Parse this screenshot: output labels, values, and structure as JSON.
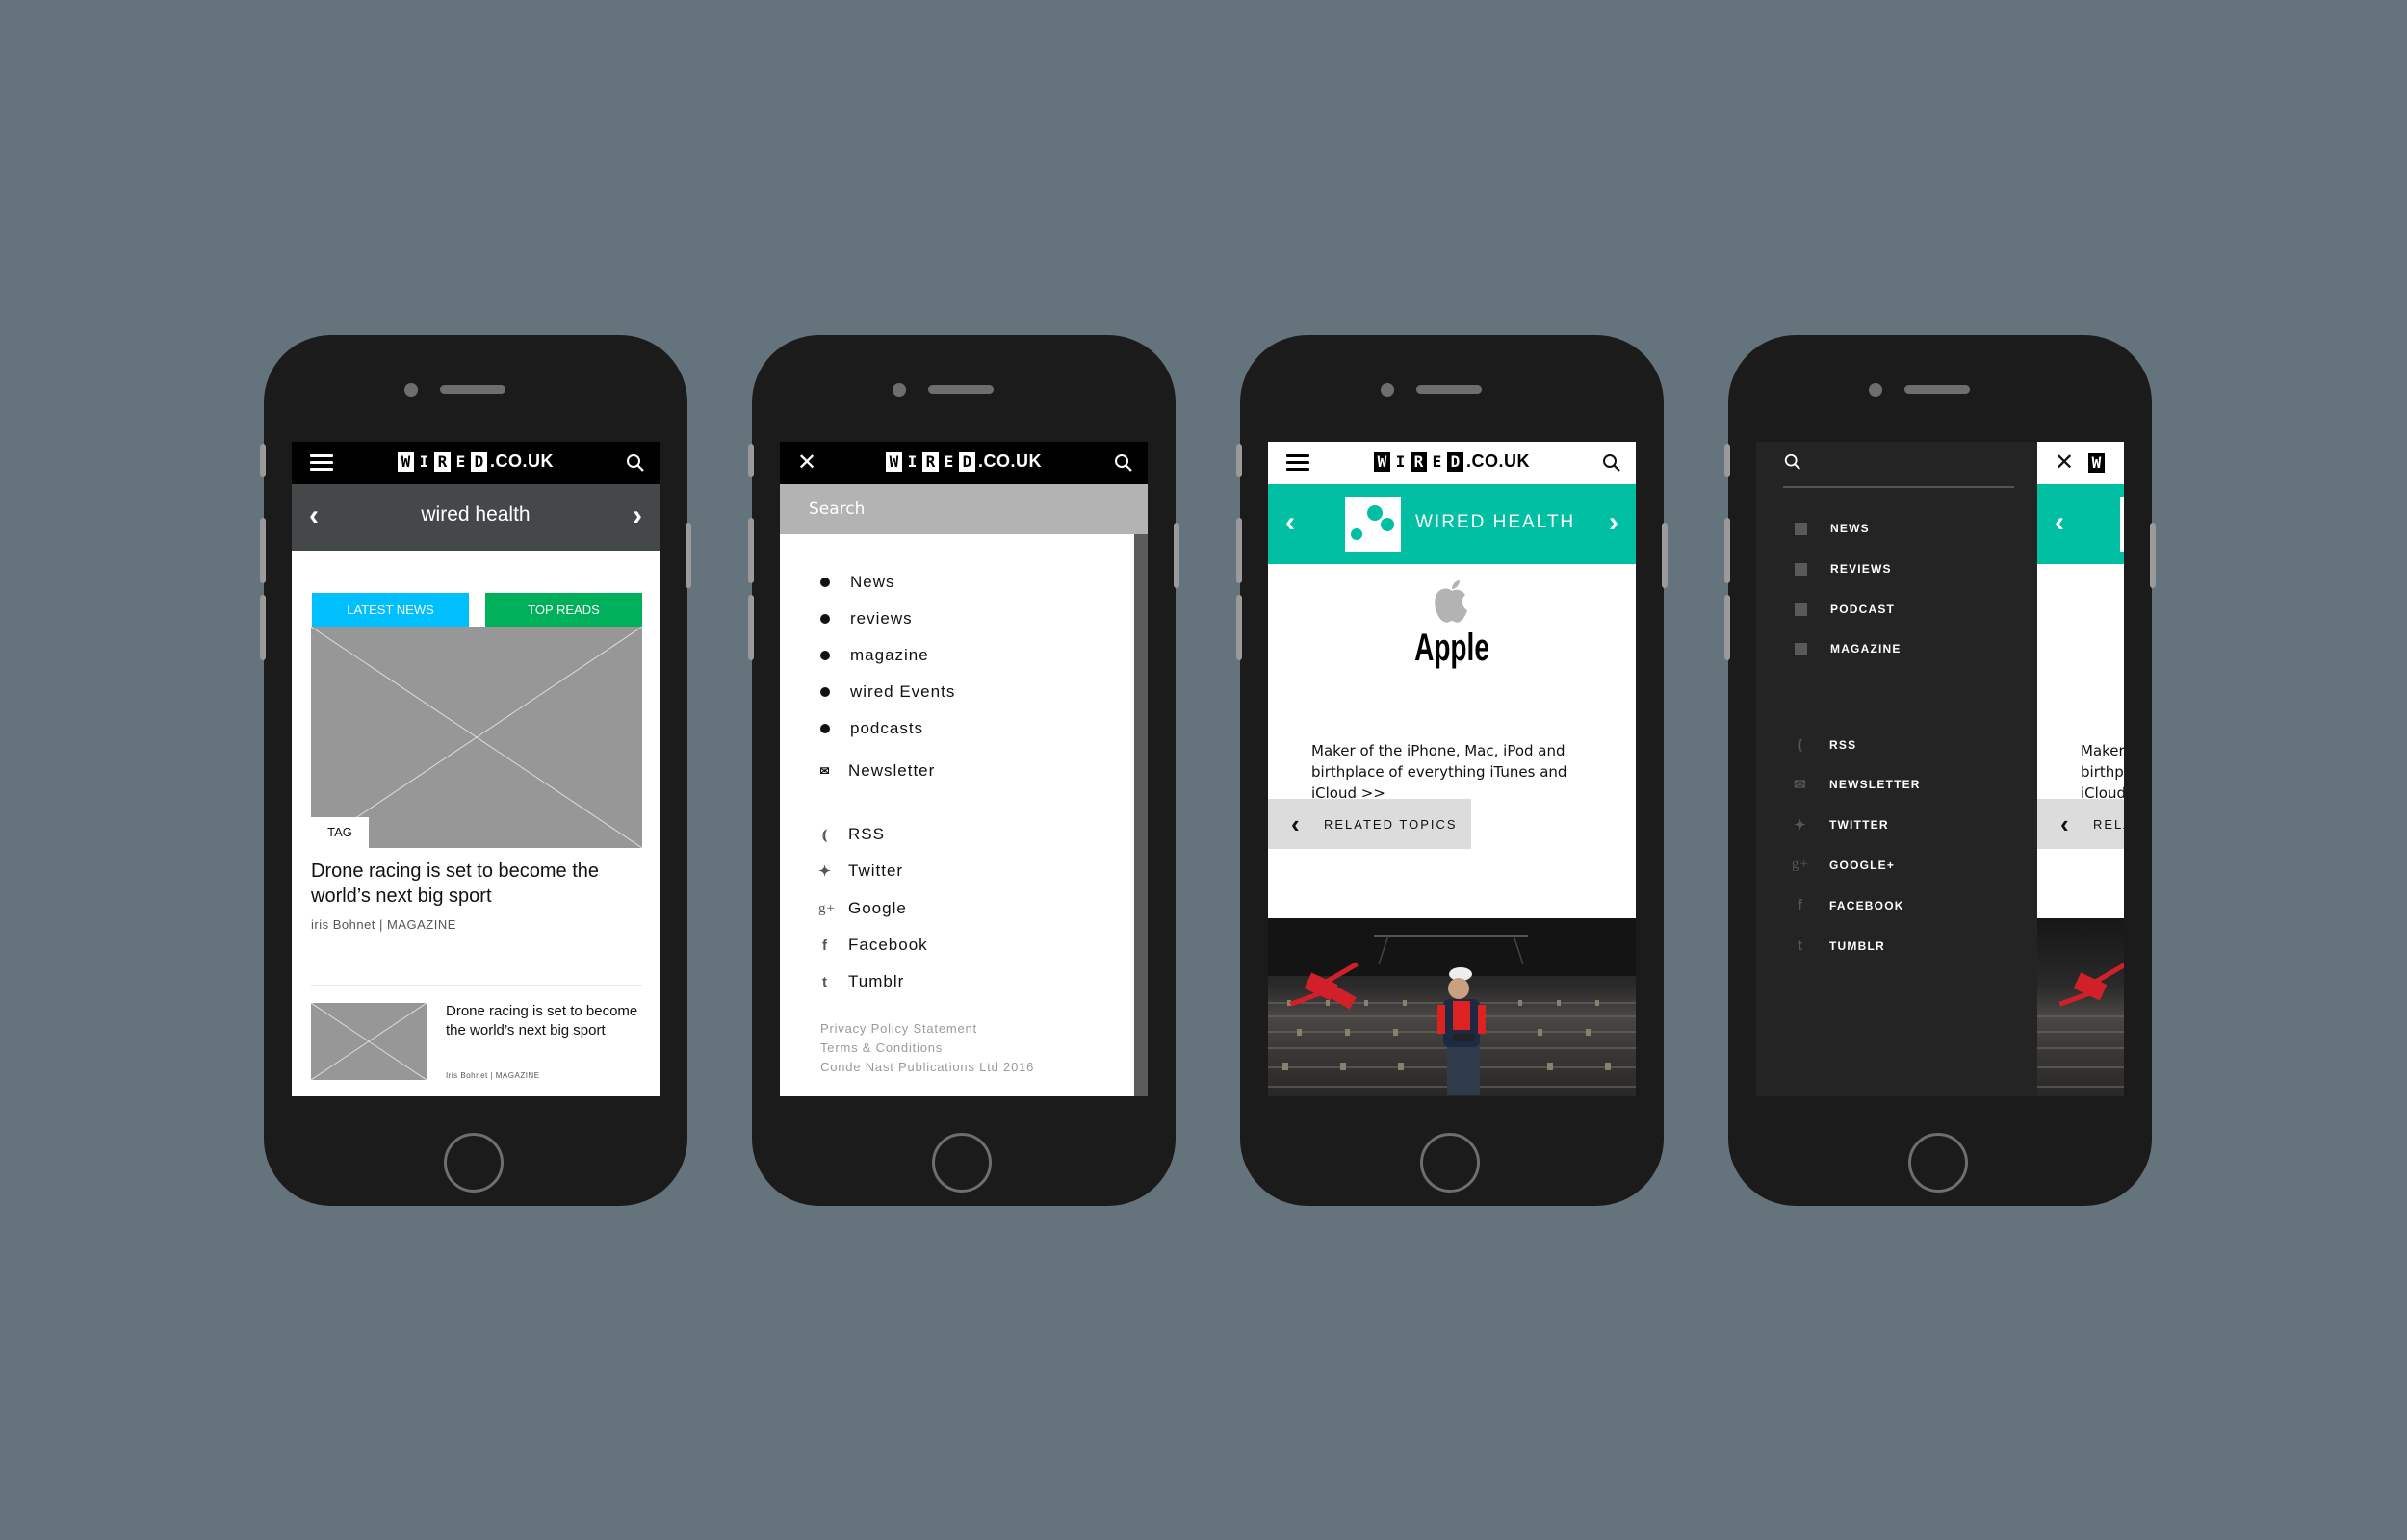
{
  "brand": {
    "logo_letters": [
      "W",
      "I",
      "R",
      "E",
      "D"
    ],
    "logo_domain": ".CO.UK",
    "accent_teal": "#00bfa3",
    "latest_blue": "#00bfff",
    "top_green": "#00b05a"
  },
  "phone1": {
    "section_title": "wired health",
    "tabs": [
      {
        "label": "LATEST NEWS"
      },
      {
        "label": "TOP READS"
      }
    ],
    "hero": {
      "tag": "TAG",
      "title": "Drone racing is set to become the world’s next big sport",
      "meta": "iris Bohnet | MAGAZINE"
    },
    "list_item": {
      "title": "Drone racing is set to become the world’s next big sport",
      "meta": "Iris Bohnet | MAGAZINE"
    }
  },
  "phone2": {
    "search_placeholder": "Search",
    "nav_items": [
      "News",
      "reviews",
      "magazine",
      "wired Events",
      "podcasts"
    ],
    "newsletter": "Newsletter",
    "social": [
      {
        "icon": "rss-icon",
        "glyph": "◝",
        "label": "RSS"
      },
      {
        "icon": "twitter-icon",
        "glyph": "🐦",
        "label": "Twitter"
      },
      {
        "icon": "google-plus-icon",
        "glyph": "g+",
        "label": "Google"
      },
      {
        "icon": "facebook-icon",
        "glyph": "f",
        "label": "Facebook"
      },
      {
        "icon": "tumblr-icon",
        "glyph": "t",
        "label": "Tumblr"
      }
    ],
    "footer": [
      "Privacy Policy Statement",
      "Terms & Conditions",
      "Conde Nast Publications Ltd 2016"
    ]
  },
  "phone3": {
    "section_title": "WIRED HEALTH",
    "topic": "Apple",
    "description": "Maker of the iPhone, Mac, iPod and birthplace of everything iTunes and iCloud >>",
    "related_label": "RELATED TOPICS"
  },
  "phone4": {
    "nav_items": [
      "NEWS",
      "REVIEWS",
      "PODCAST",
      "MAGAZINE"
    ],
    "social": [
      {
        "icon": "rss-icon",
        "label": "RSS"
      },
      {
        "icon": "newsletter-icon",
        "label": "NEWSLETTER"
      },
      {
        "icon": "twitter-icon",
        "label": "TWITTER"
      },
      {
        "icon": "google-plus-icon",
        "label": "GOOGLE+"
      },
      {
        "icon": "facebook-icon",
        "label": "FACEBOOK"
      },
      {
        "icon": "tumblr-icon",
        "label": "TUMBLR"
      }
    ],
    "peek_desc": [
      "Maker",
      "birthp",
      "iCloud"
    ],
    "peek_related": "RELA"
  }
}
